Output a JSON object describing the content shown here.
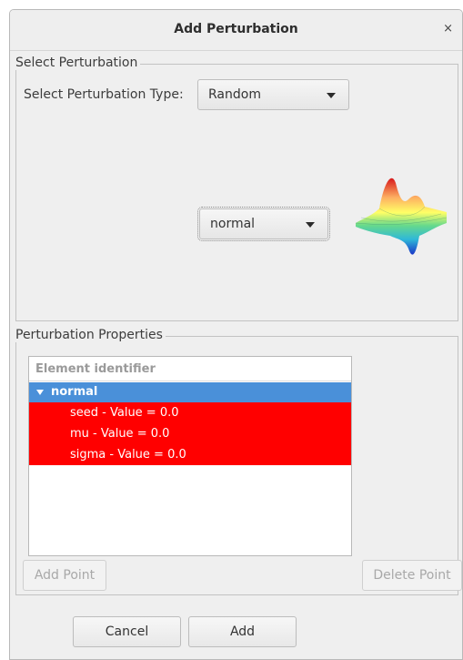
{
  "window": {
    "title": "Add Perturbation",
    "close_glyph": "×"
  },
  "select_group": {
    "title": "Select Perturbation",
    "type_label": "Select Perturbation Type:",
    "type_value": "Random",
    "distribution_value": "normal",
    "preview_icon": "3d-surface-plot-icon"
  },
  "properties_group": {
    "title": "Perturbation Properties",
    "tree": {
      "header": "Element identifier",
      "parent": "normal",
      "children": [
        "seed - Value = 0.0",
        "mu - Value = 0.0",
        "sigma - Value = 0.0"
      ]
    },
    "add_point": "Add Point",
    "delete_point": "Delete Point"
  },
  "footer": {
    "cancel": "Cancel",
    "add": "Add"
  },
  "colors": {
    "selection": "#4a90d9",
    "invalid_row": "#ff0000",
    "dialog_bg": "#efefef"
  }
}
